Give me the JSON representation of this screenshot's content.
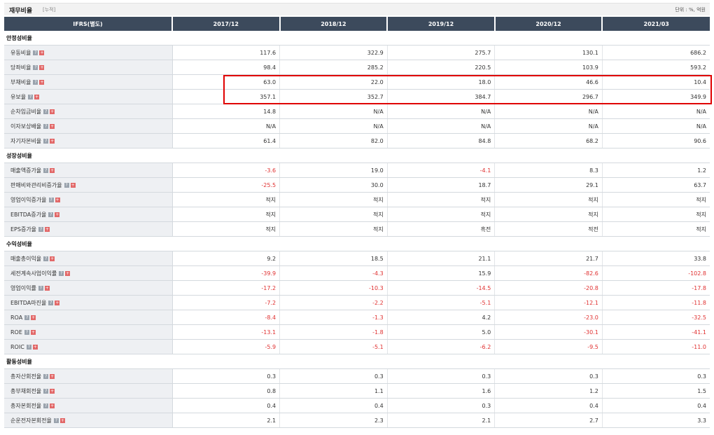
{
  "header": {
    "title": "재무비율",
    "subtitle": "[누적]",
    "unit": "단위 : %, 억원"
  },
  "columns": [
    "IFRS(별도)",
    "2017/12",
    "2018/12",
    "2019/12",
    "2020/12",
    "2021/03"
  ],
  "sections": [
    {
      "title": "안정성비율",
      "rows": [
        {
          "label": "유동비율",
          "values": [
            "117.6",
            "322.9",
            "275.7",
            "130.1",
            "686.2"
          ]
        },
        {
          "label": "당좌비율",
          "values": [
            "98.4",
            "285.2",
            "220.5",
            "103.9",
            "593.2"
          ]
        },
        {
          "label": "부채비율",
          "values": [
            "63.0",
            "22.0",
            "18.0",
            "46.6",
            "10.4"
          ]
        },
        {
          "label": "유보율",
          "values": [
            "357.1",
            "352.7",
            "384.7",
            "296.7",
            "349.9"
          ]
        },
        {
          "label": "순차입금비율",
          "values": [
            "14.8",
            "N/A",
            "N/A",
            "N/A",
            "N/A"
          ]
        },
        {
          "label": "이자보상배율",
          "values": [
            "N/A",
            "N/A",
            "N/A",
            "N/A",
            "N/A"
          ]
        },
        {
          "label": "자기자본비율",
          "values": [
            "61.4",
            "82.0",
            "84.8",
            "68.2",
            "90.6"
          ]
        }
      ]
    },
    {
      "title": "성장성비율",
      "rows": [
        {
          "label": "매출액증가율",
          "values": [
            "-3.6",
            "19.0",
            "-4.1",
            "8.3",
            "1.2"
          ]
        },
        {
          "label": "판매비와관리비증가율",
          "values": [
            "-25.5",
            "30.0",
            "18.7",
            "29.1",
            "63.7"
          ]
        },
        {
          "label": "영업이익증가율",
          "values": [
            "적지",
            "적지",
            "적지",
            "적지",
            "적지"
          ]
        },
        {
          "label": "EBITDA증가율",
          "values": [
            "적지",
            "적지",
            "적지",
            "적지",
            "적지"
          ]
        },
        {
          "label": "EPS증가율",
          "values": [
            "적지",
            "적지",
            "흑전",
            "적전",
            "적지"
          ]
        }
      ]
    },
    {
      "title": "수익성비율",
      "rows": [
        {
          "label": "매출총이익율",
          "values": [
            "9.2",
            "18.5",
            "21.1",
            "21.7",
            "33.8"
          ]
        },
        {
          "label": "세전계속사업이익률",
          "values": [
            "-39.9",
            "-4.3",
            "15.9",
            "-82.6",
            "-102.8"
          ]
        },
        {
          "label": "영업이익률",
          "values": [
            "-17.2",
            "-10.3",
            "-14.5",
            "-20.8",
            "-17.8"
          ]
        },
        {
          "label": "EBITDA마진율",
          "values": [
            "-7.2",
            "-2.2",
            "-5.1",
            "-12.1",
            "-11.8"
          ]
        },
        {
          "label": "ROA",
          "values": [
            "-8.4",
            "-1.3",
            "4.2",
            "-23.0",
            "-32.5"
          ]
        },
        {
          "label": "ROE",
          "values": [
            "-13.1",
            "-1.8",
            "5.0",
            "-30.1",
            "-41.1"
          ]
        },
        {
          "label": "ROIC",
          "values": [
            "-5.9",
            "-5.1",
            "-6.2",
            "-9.5",
            "-11.0"
          ]
        }
      ]
    },
    {
      "title": "활동성비율",
      "rows": [
        {
          "label": "총자산회전율",
          "values": [
            "0.3",
            "0.3",
            "0.3",
            "0.3",
            "0.3"
          ]
        },
        {
          "label": "총부채회전율",
          "values": [
            "0.8",
            "1.1",
            "1.6",
            "1.2",
            "1.5"
          ]
        },
        {
          "label": "총자본회전율",
          "values": [
            "0.4",
            "0.4",
            "0.3",
            "0.4",
            "0.4"
          ]
        },
        {
          "label": "순운전자본회전율",
          "values": [
            "2.1",
            "2.3",
            "2.1",
            "2.7",
            "3.3"
          ]
        }
      ]
    }
  ],
  "icons": {
    "help": "?",
    "plus": "+"
  },
  "colors": {
    "header_bg": "#3c4a5c",
    "negative": "#e03030",
    "highlight": "#e00000"
  }
}
